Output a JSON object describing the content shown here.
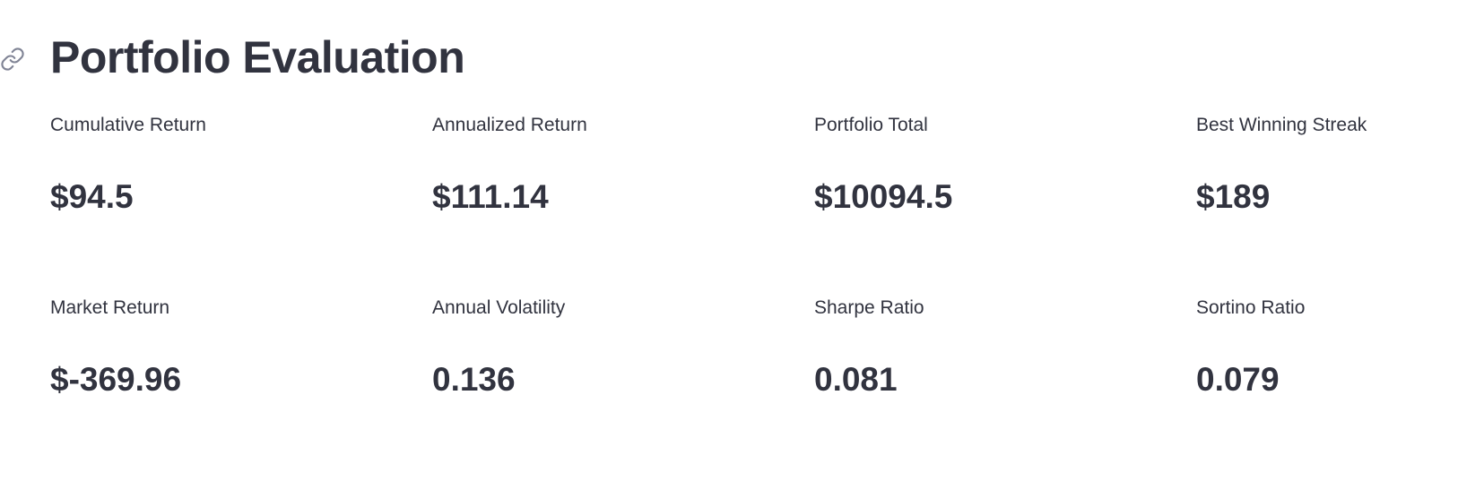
{
  "header": {
    "title": "Portfolio Evaluation",
    "anchor_icon": "link-icon"
  },
  "metrics": [
    {
      "label": "Cumulative Return",
      "value": "$94.5"
    },
    {
      "label": "Annualized Return",
      "value": "$111.14"
    },
    {
      "label": "Portfolio Total",
      "value": "$10094.5"
    },
    {
      "label": "Best Winning Streak",
      "value": "$189"
    },
    {
      "label": "Market Return",
      "value": "$-369.96"
    },
    {
      "label": "Annual Volatility",
      "value": "0.136"
    },
    {
      "label": "Sharpe Ratio",
      "value": "0.081"
    },
    {
      "label": "Sortino Ratio",
      "value": "0.079"
    }
  ],
  "colors": {
    "text": "#31333f",
    "icon": "#808495",
    "background": "#ffffff"
  }
}
